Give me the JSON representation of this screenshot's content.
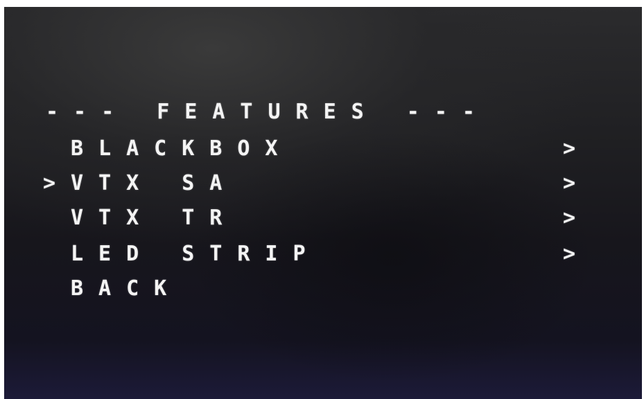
{
  "menu": {
    "title": "--- FEATURES ---",
    "cursor": ">",
    "items": [
      {
        "label": "BLACKBOX",
        "arrow": ">"
      },
      {
        "label": "VTX SA",
        "arrow": ">"
      },
      {
        "label": "VTX TR",
        "arrow": ">"
      },
      {
        "label": "LED STRIP",
        "arrow": ">"
      },
      {
        "label": "BACK"
      }
    ],
    "selected_item": "VTX SA"
  }
}
